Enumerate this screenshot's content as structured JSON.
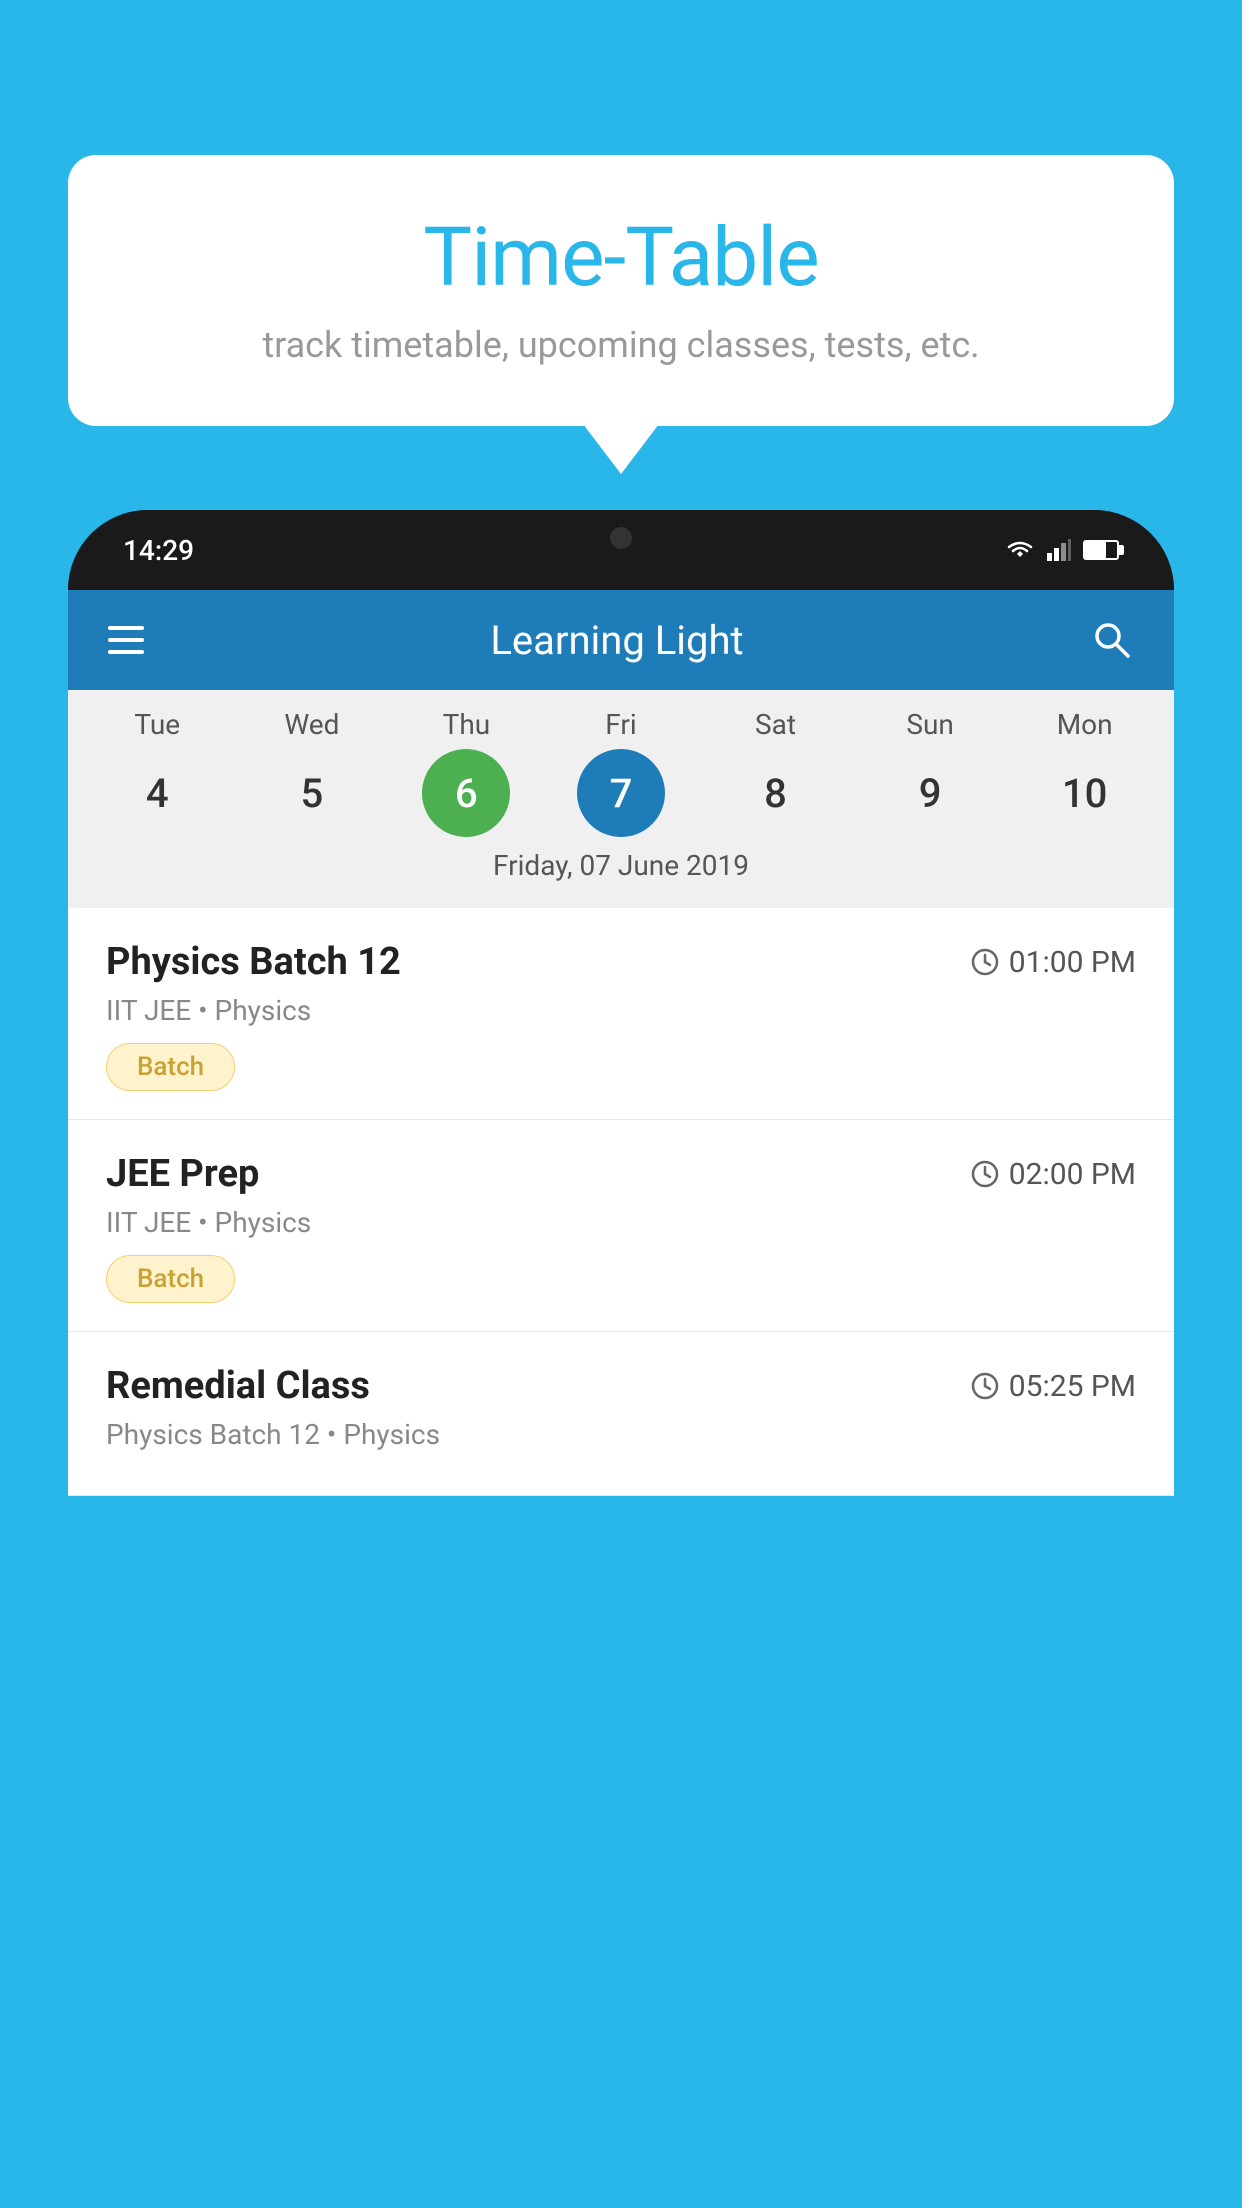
{
  "background_color": "#29b6e8",
  "bubble": {
    "title": "Time-Table",
    "subtitle": "track timetable, upcoming classes, tests, etc."
  },
  "status_bar": {
    "time": "14:29"
  },
  "app_header": {
    "title": "Learning Light"
  },
  "calendar": {
    "days": [
      {
        "label": "Tue",
        "number": "4"
      },
      {
        "label": "Wed",
        "number": "5"
      },
      {
        "label": "Thu",
        "number": "6",
        "state": "today"
      },
      {
        "label": "Fri",
        "number": "7",
        "state": "selected"
      },
      {
        "label": "Sat",
        "number": "8"
      },
      {
        "label": "Sun",
        "number": "9"
      },
      {
        "label": "Mon",
        "number": "10"
      }
    ],
    "selected_date_label": "Friday, 07 June 2019"
  },
  "schedule": [
    {
      "title": "Physics Batch 12",
      "time": "01:00 PM",
      "meta": "IIT JEE • Physics",
      "badge": "Batch"
    },
    {
      "title": "JEE Prep",
      "time": "02:00 PM",
      "meta": "IIT JEE • Physics",
      "badge": "Batch"
    },
    {
      "title": "Remedial Class",
      "time": "05:25 PM",
      "meta": "Physics Batch 12 • Physics",
      "badge": ""
    }
  ],
  "icons": {
    "hamburger": "≡",
    "search": "🔍",
    "clock": "🕐"
  }
}
